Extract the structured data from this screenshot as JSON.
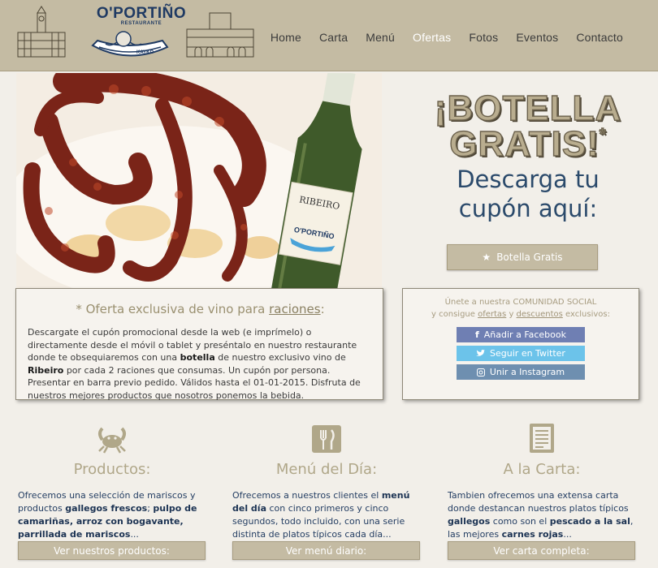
{
  "brand": {
    "name": "O'PORTIÑO",
    "tagline": "RESTAURANTE",
    "boat_label": "KAYKO"
  },
  "nav": {
    "items": [
      {
        "label": "Home",
        "active": false
      },
      {
        "label": "Carta",
        "active": false
      },
      {
        "label": "Menú",
        "active": false
      },
      {
        "label": "Ofertas",
        "active": true
      },
      {
        "label": "Fotos",
        "active": false
      },
      {
        "label": "Eventos",
        "active": false
      },
      {
        "label": "Contacto",
        "active": false
      }
    ]
  },
  "hero": {
    "bottle_label": "RIBEIRO",
    "bottle_brand": "O'PORTIÑO",
    "promo_line1": "¡BOTELLA",
    "promo_line2": "GRATIS!",
    "promo_star": "*",
    "download_line1": "Descarga tu",
    "download_line2": "cupón aquí:",
    "coupon_button": "Botella Gratis",
    "coupon_icon": "star-icon"
  },
  "offer": {
    "heading_prefix": "* Oferta exclusiva de vino para ",
    "heading_link": "raciones",
    "heading_suffix": ":",
    "text_1": "Descargate el cupón promocional desde la web (e imprímelo) o directamente desde el móvil o tablet y preséntalo en nuestro restaurante donde te obsequiaremos con una ",
    "text_bold_1": "botella",
    "text_2": " de nuestro exclusivo vino de ",
    "text_bold_2": "Ribeiro",
    "text_3": " por cada 2 raciones que consumas. Un cupón por persona. Presentar en barra previo pedido. Válidos hasta el 01-01-2015. Disfruta de nuestros mejores productos que nosotros ponemos la bebida."
  },
  "social": {
    "line1": "Únete a nuestra COMUNIDAD SOCIAL",
    "line2_prefix": "y consigue ",
    "line2_link1": "ofertas",
    "line2_mid": " y ",
    "line2_link2": "descuentos",
    "line2_suffix": " exclusivos:",
    "facebook": "Añadir a Facebook",
    "twitter": "Seguir en Twitter",
    "instagram": "Unir a Instagram",
    "colors": {
      "facebook": "#6f7fb3",
      "twitter": "#6cc3ea",
      "instagram": "#6e8fb0"
    }
  },
  "features": [
    {
      "icon": "crab-icon",
      "title": "Productos:",
      "d1": "Ofrecemos una selección de mariscos y productos ",
      "b1": "gallegos frescos",
      "d2": "; ",
      "b2": "pulpo de camariñas, arroz con bogavante, parrillada de mariscos",
      "d3": "...",
      "button": "Ver nuestros productos:"
    },
    {
      "icon": "fork-knife-icon",
      "title": "Menú del Día:",
      "d1": "Ofrecemos a nuestros clientes el ",
      "b1": "menú del día",
      "d2": " con cinco primeros y cinco segundos, todo incluido, con una serie distinta de platos típicos cada día...",
      "b2": "",
      "d3": "",
      "button": "Ver menú diario:"
    },
    {
      "icon": "menu-list-icon",
      "title": "A la Carta:",
      "d1": "Tambien ofrecemos una extensa carta donde destancan nuestros platos típicos ",
      "b1": "gallegos",
      "d2": " como son el ",
      "b2": "pescado a la sal",
      "d3": ", las mejores ",
      "b3": "carnes rojas",
      "d4": "...",
      "button": "Ver carta completa:"
    }
  ],
  "colors": {
    "header_bg": "#c4bba3",
    "page_bg": "#f2efe9",
    "accent_text": "#b0a789",
    "link_blue": "#243e63"
  }
}
